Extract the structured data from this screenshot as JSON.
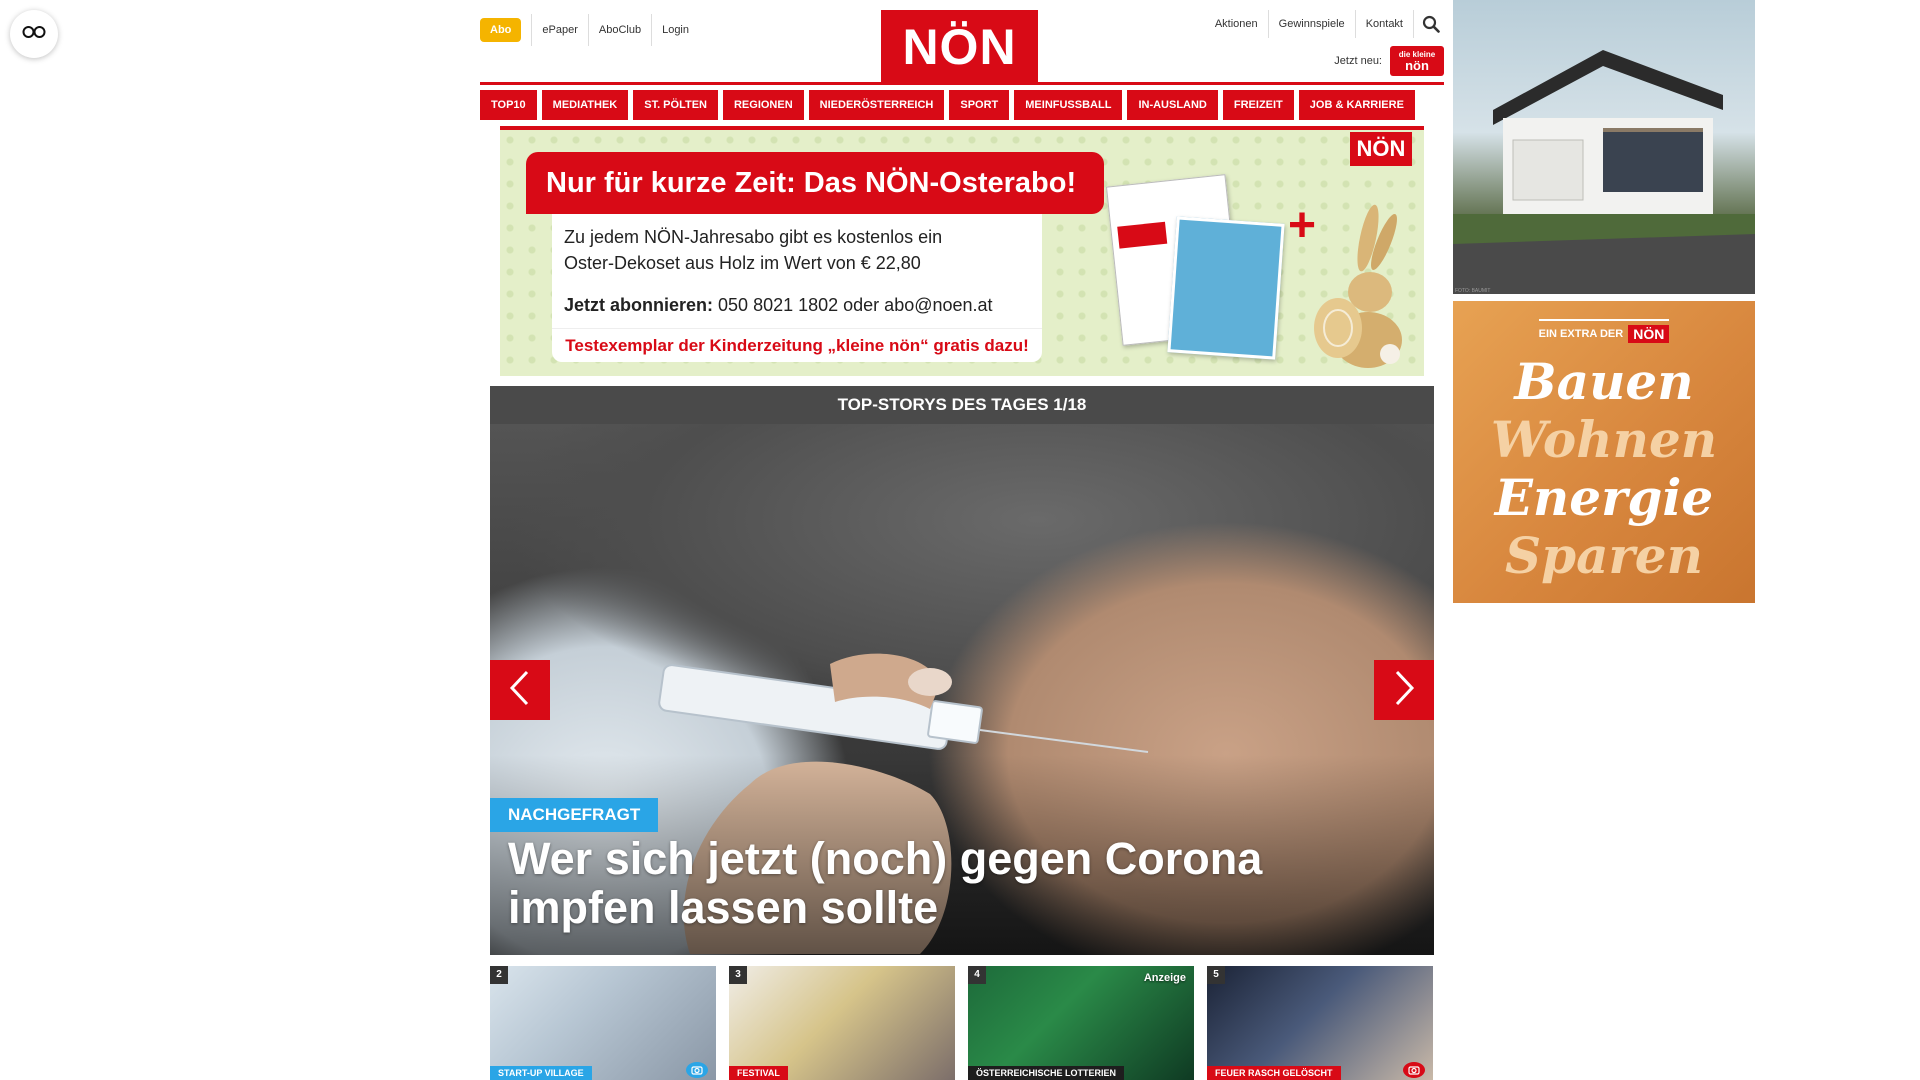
{
  "accessibility": {
    "icon": "glasses-icon"
  },
  "utility_left": {
    "abo": "Abo",
    "links": [
      "ePaper",
      "AboClub",
      "Login"
    ]
  },
  "logo": {
    "text": "NÖN"
  },
  "utility_right": {
    "links": [
      "Aktionen",
      "Gewinnspiele",
      "Kontakt"
    ],
    "search_icon": "search-icon"
  },
  "jetzt_neu": {
    "label": "Jetzt neu:",
    "badge_line1": "die kleine",
    "badge_line2": "nön"
  },
  "nav": {
    "items": [
      "TOP10",
      "MEDIATHEK",
      "ST. PÖLTEN",
      "REGIONEN",
      "NIEDERÖSTERREICH",
      "SPORT",
      "MEINFUSSBALL",
      "IN-AUSLAND",
      "FREIZEIT",
      "JOB & KARRIERE"
    ]
  },
  "promo": {
    "headline": "Nur für kurze Zeit: Das NÖN-Osterabo!",
    "body_line1": "Zu jedem NÖN-Jahresabo gibt es kostenlos ein",
    "body_line2": "Oster-Dekoset aus Holz im Wert von € 22,80",
    "cta_bold": "Jetzt abonnieren:",
    "cta_rest": " 050 8021 1802 oder abo@noen.at",
    "footer": "Testexemplar der Kinderzeitung „kleine nön“ gratis dazu!",
    "corner_logo": "NÖN",
    "plus": "+"
  },
  "top_stories": {
    "header": "TOP-STORYS DES TAGES 1/18",
    "hero": {
      "tag": "NACHGEFRAGT",
      "title": "Wer sich jetzt (noch) gegen Corona impfen lassen sollte",
      "prev_icon": "chevron-left-icon",
      "next_icon": "chevron-right-icon"
    },
    "thumbs": [
      {
        "num": "2",
        "category": "START-UP VILLAGE",
        "cat_color": "#2aa5e6",
        "badge": "",
        "camera": true
      },
      {
        "num": "3",
        "category": "FESTIVAL",
        "cat_color": "#d80a16",
        "badge": "",
        "camera": false
      },
      {
        "num": "4",
        "category": "ÖSTERREICHISCHE LOTTERIEN",
        "cat_color": "#1e1e1e",
        "badge": "Anzeige",
        "camera": false
      },
      {
        "num": "5",
        "category": "FEUER RASCH GELÖSCHT",
        "cat_color": "#d80a16",
        "badge": "",
        "camera": true
      }
    ]
  },
  "ads": {
    "house_credit": "FOTO: BAUMIT",
    "bauen_extra": "EIN EXTRA DER",
    "bauen_logo": "NÖN",
    "bauen_words": [
      "Bauen",
      "Wohnen",
      "Energie",
      "Sparen"
    ]
  }
}
